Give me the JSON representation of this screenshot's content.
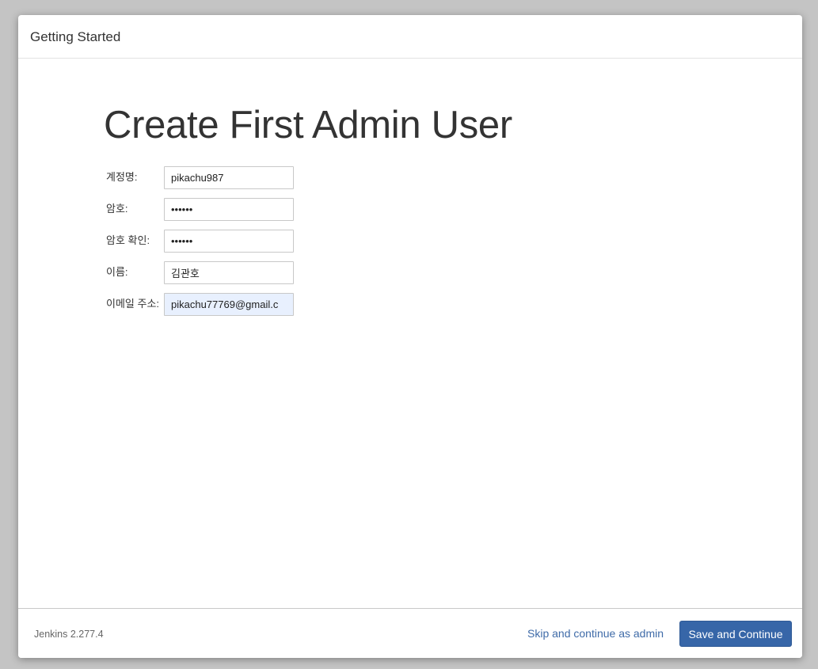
{
  "header": {
    "title": "Getting Started"
  },
  "main": {
    "heading": "Create First Admin User",
    "fields": [
      {
        "label": "계정명:",
        "value": "pikachu987",
        "type": "text"
      },
      {
        "label": "암호:",
        "value": "••••••",
        "type": "password"
      },
      {
        "label": "암호 확인:",
        "value": "••••••",
        "type": "password"
      },
      {
        "label": "이름:",
        "value": "김관호",
        "type": "text"
      },
      {
        "label": "이메일 주소:",
        "value": "pikachu77769@gmail.c",
        "type": "email"
      }
    ]
  },
  "footer": {
    "version": "Jenkins 2.277.4",
    "skip_label": "Skip and continue as admin",
    "save_label": "Save and Continue"
  },
  "colors": {
    "primary_button": "#3766a8",
    "link": "#3f6ba8",
    "autofill_background": "#e8f0fe"
  }
}
